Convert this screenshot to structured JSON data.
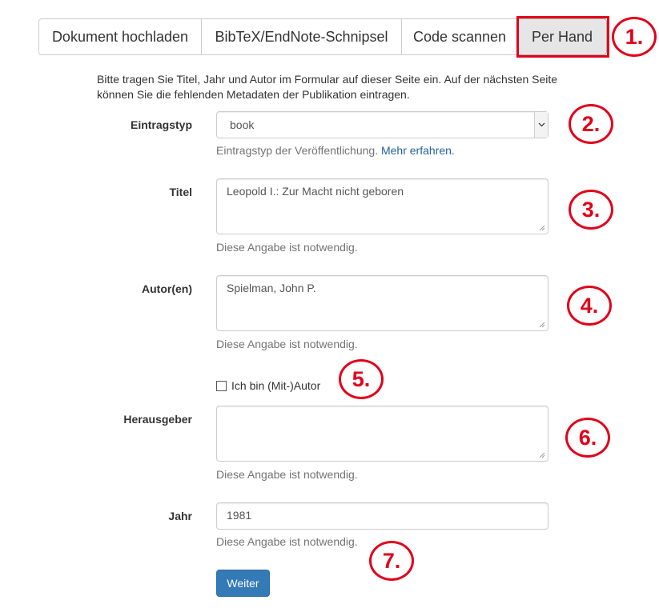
{
  "tabs": [
    {
      "label": "Dokument hochladen"
    },
    {
      "label": "BibTeX/EndNote-Schnipsel"
    },
    {
      "label": "Code scannen"
    },
    {
      "label": "Per Hand"
    }
  ],
  "intro_text": "Bitte tragen Sie Titel, Jahr und Autor im Formular auf dieser Seite ein. Auf der nächsten Seite können Sie die fehlenden Metadaten der Publikation eintragen.",
  "form": {
    "entrytype": {
      "label": "Eintragstyp",
      "value": "book",
      "help_text": "Eintragstyp der Veröffentlichung.",
      "help_link": "Mehr erfahren."
    },
    "title": {
      "label": "Titel",
      "value": "Leopold I.: Zur Macht nicht geboren",
      "help": "Diese Angabe ist notwendig."
    },
    "authors": {
      "label": "Autor(en)",
      "value": "Spielman, John P.",
      "help": "Diese Angabe ist notwendig."
    },
    "coauthor_checkbox": {
      "label": "Ich bin (Mit-)Autor",
      "checked": false
    },
    "editor": {
      "label": "Herausgeber",
      "value": "",
      "help": "Diese Angabe ist notwendig."
    },
    "year": {
      "label": "Jahr",
      "value": "1981",
      "help": "Diese Angabe ist notwendig."
    },
    "submit_label": "Weiter"
  },
  "markers": [
    "1.",
    "2.",
    "3.",
    "4.",
    "5.",
    "6.",
    "7."
  ],
  "colors": {
    "marker_red": "#e2001a",
    "primary_button": "#337ab7",
    "link": "#23639c"
  }
}
